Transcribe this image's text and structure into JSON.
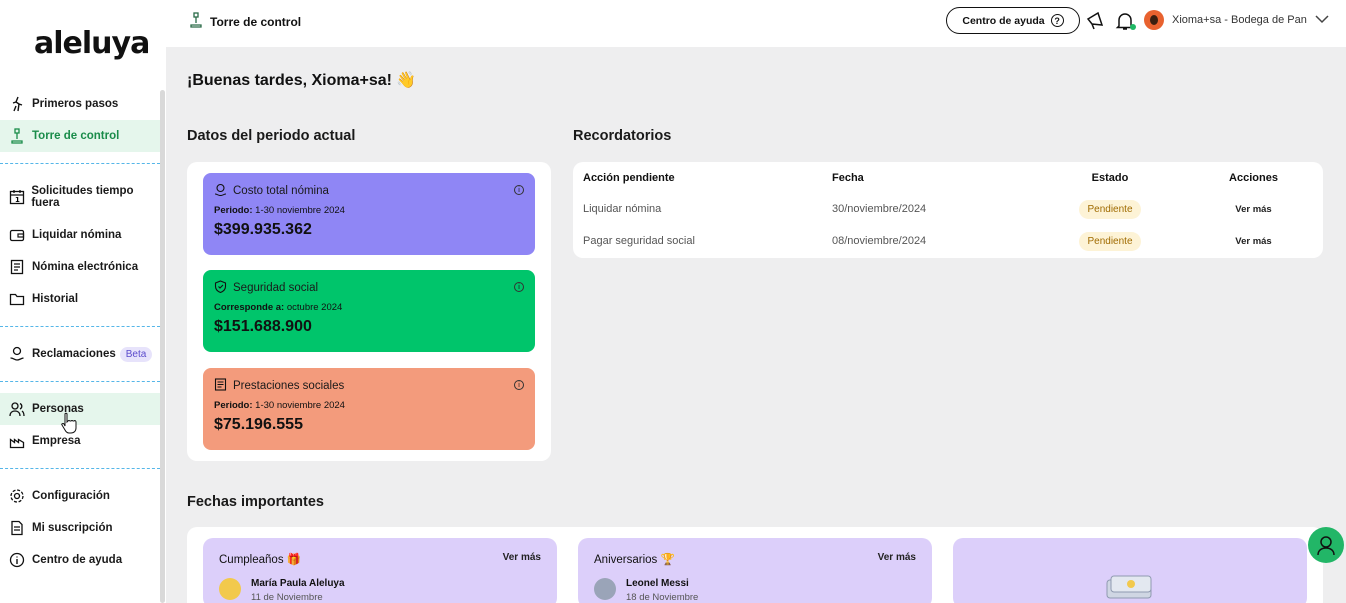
{
  "app": {
    "logo": "aleluya"
  },
  "sidebar": {
    "items": [
      {
        "label": "Primeros pasos",
        "icon": "steps-icon"
      },
      {
        "label": "Torre de control",
        "icon": "control-tower-icon"
      },
      {
        "label": "Solicitudes tiempo fuera",
        "icon": "calendar-icon"
      },
      {
        "label": "Liquidar nómina",
        "icon": "wallet-icon"
      },
      {
        "label": "Nómina electrónica",
        "icon": "receipt-icon"
      },
      {
        "label": "Historial",
        "icon": "folder-icon"
      },
      {
        "label": "Reclamaciones",
        "badge": "Beta",
        "icon": "claims-icon"
      },
      {
        "label": "Personas",
        "icon": "people-icon"
      },
      {
        "label": "Empresa",
        "icon": "factory-icon"
      },
      {
        "label": "Configuración",
        "icon": "gear-icon"
      },
      {
        "label": "Mi suscripción",
        "icon": "document-icon"
      },
      {
        "label": "Centro de ayuda",
        "icon": "info-icon"
      }
    ]
  },
  "topbar": {
    "breadcrumb": "Torre de control",
    "help_label": "Centro de ayuda",
    "help_icon": "?",
    "company": "Xioma+sa - Bodega de Pan"
  },
  "main": {
    "greeting": "¡Buenas tardes, Xioma+sa! 👋",
    "period_title": "Datos del periodo actual",
    "reminders_title": "Recordatorios",
    "dates_title": "Fechas importantes",
    "kpis": [
      {
        "title": "Costo total nómina",
        "sub_label": "Periodo:",
        "sub_value": " 1-30 noviembre 2024",
        "amount": "$399.935.362",
        "color": "#8f86f5"
      },
      {
        "title": "Seguridad social",
        "sub_label": "Corresponde a:",
        "sub_value": " octubre 2024",
        "amount": "$151.688.900",
        "color": "#00c56b"
      },
      {
        "title": "Prestaciones sociales",
        "sub_label": "Periodo:",
        "sub_value": " 1-30 noviembre 2024",
        "amount": "$75.196.555",
        "color": "#f39b7c"
      }
    ],
    "reminders": {
      "headers": [
        "Acción pendiente",
        "Fecha",
        "Estado",
        "Acciones"
      ],
      "rows": [
        {
          "action": "Liquidar nómina",
          "date": "30/noviembre/2024",
          "status": "Pendiente",
          "link": "Ver más"
        },
        {
          "action": "Pagar seguridad social",
          "date": "08/noviembre/2024",
          "status": "Pendiente",
          "link": "Ver más"
        }
      ]
    },
    "dates": [
      {
        "title": "Cumpleaños 🎁",
        "link": "Ver más",
        "person": "María Paula Aleluya",
        "date": "11 de Noviembre"
      },
      {
        "title": "Aniversarios 🏆",
        "link": "Ver más",
        "person": "Leonel Messi",
        "date": "18 de Noviembre"
      }
    ]
  }
}
